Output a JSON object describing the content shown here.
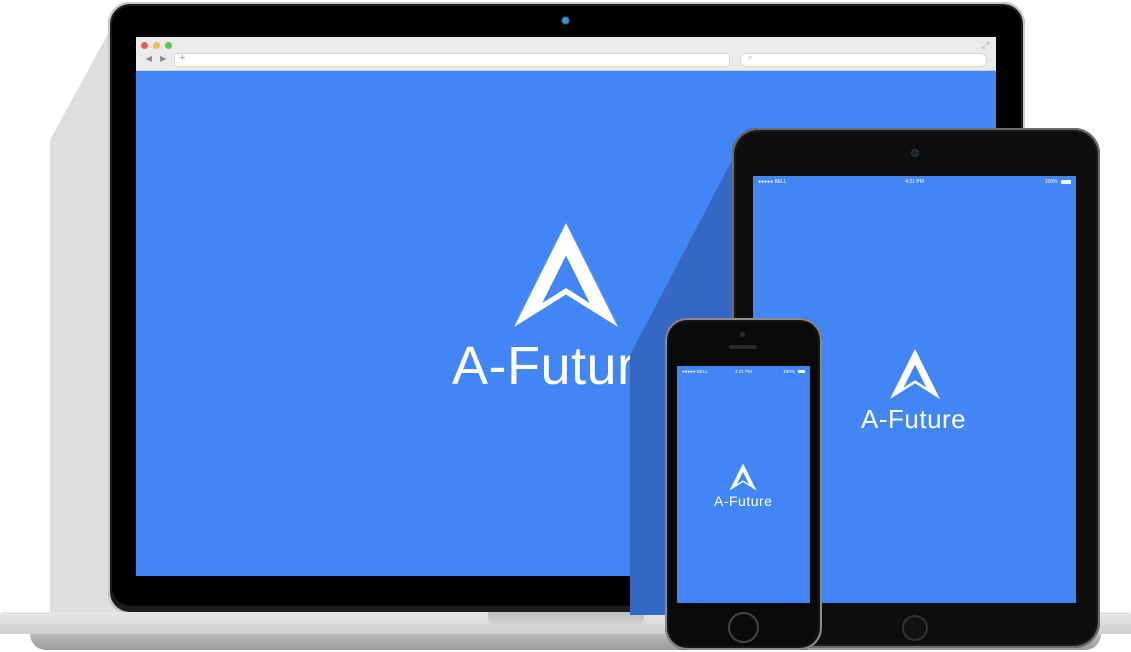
{
  "brand": {
    "name": "A-Future",
    "color": "#ffffff",
    "screen_color": "#4285f4"
  },
  "browser": {
    "window_controls": [
      "close",
      "minimize",
      "zoom"
    ],
    "nav_back": "◀",
    "nav_forward": "▶",
    "address_placeholder": "",
    "new_tab_symbol": "+",
    "search_symbol": "⌕",
    "expand_symbol": "⤢"
  },
  "tablet": {
    "status": {
      "carrier": "●●●●● BELL",
      "time": "4:21 PM",
      "battery": "100%"
    }
  },
  "phone": {
    "status": {
      "carrier": "●●●●● BELL",
      "time": "4:21 PM",
      "battery": "100%"
    }
  },
  "icons": {
    "logo": "a-future-logo-icon",
    "camera": "camera-icon",
    "home_button": "home-button-icon",
    "battery": "battery-icon"
  }
}
